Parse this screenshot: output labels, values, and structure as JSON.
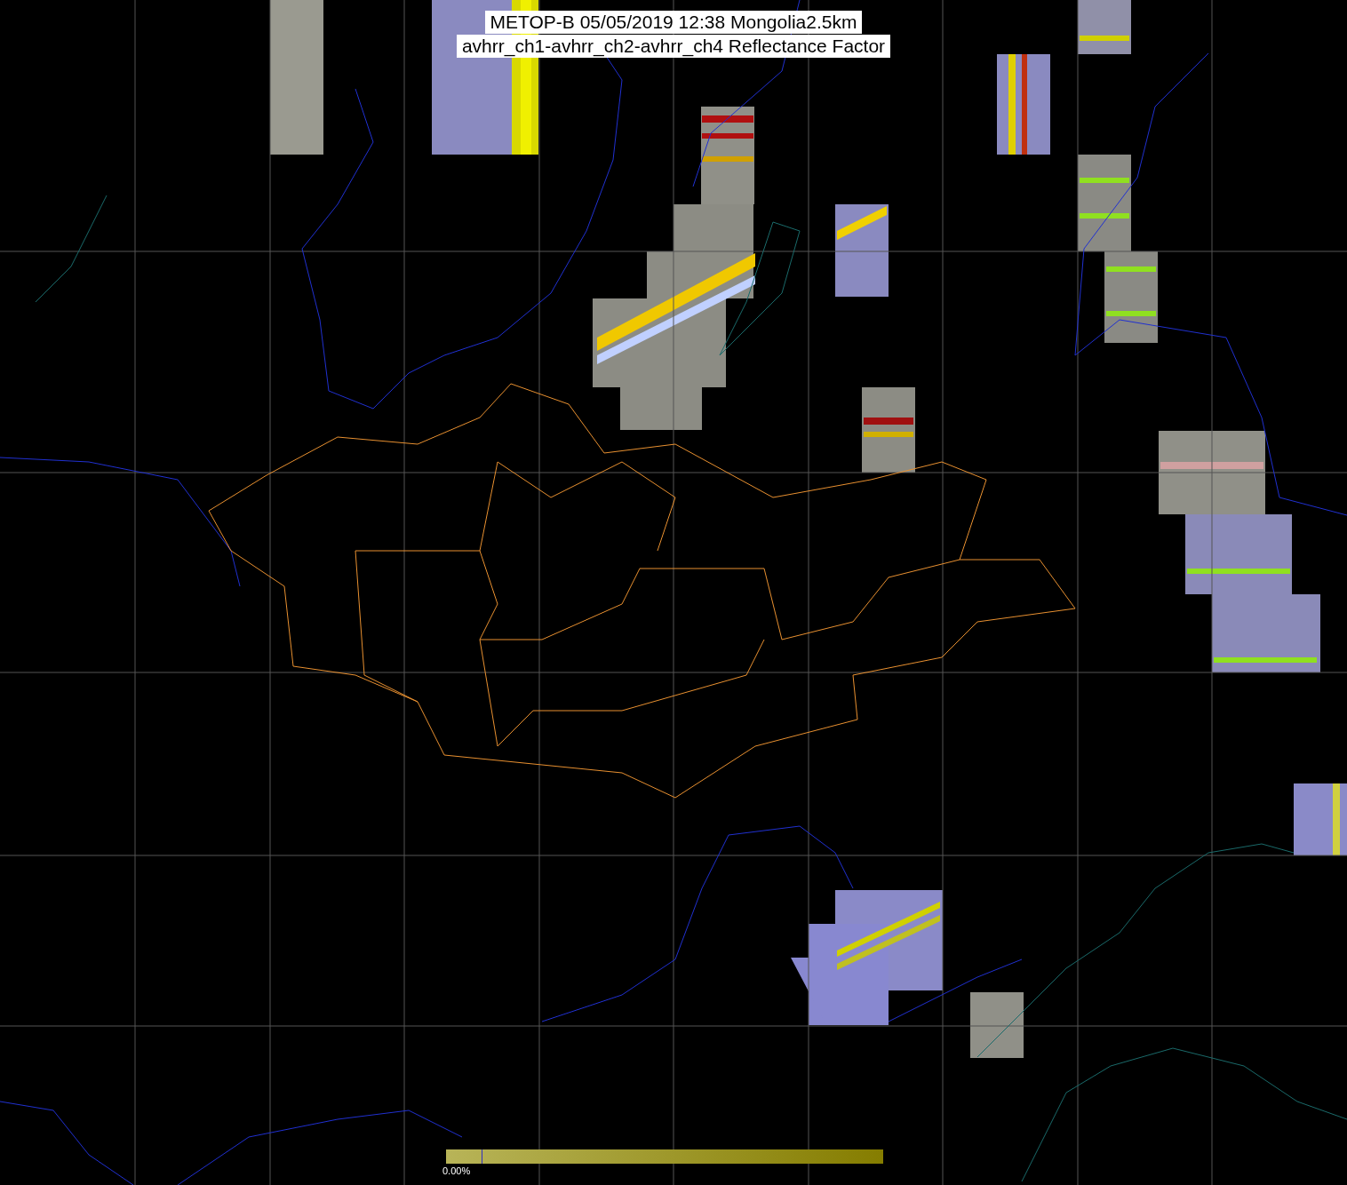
{
  "title": {
    "line_1": "METOP-B 05/05/2019 12:38 Mongolia2.5km",
    "line_2": "avhrr_ch1-avhrr_ch2-avhrr_ch4 Reflectance Factor"
  },
  "colorbar": {
    "min_label": "0.00%"
  }
}
